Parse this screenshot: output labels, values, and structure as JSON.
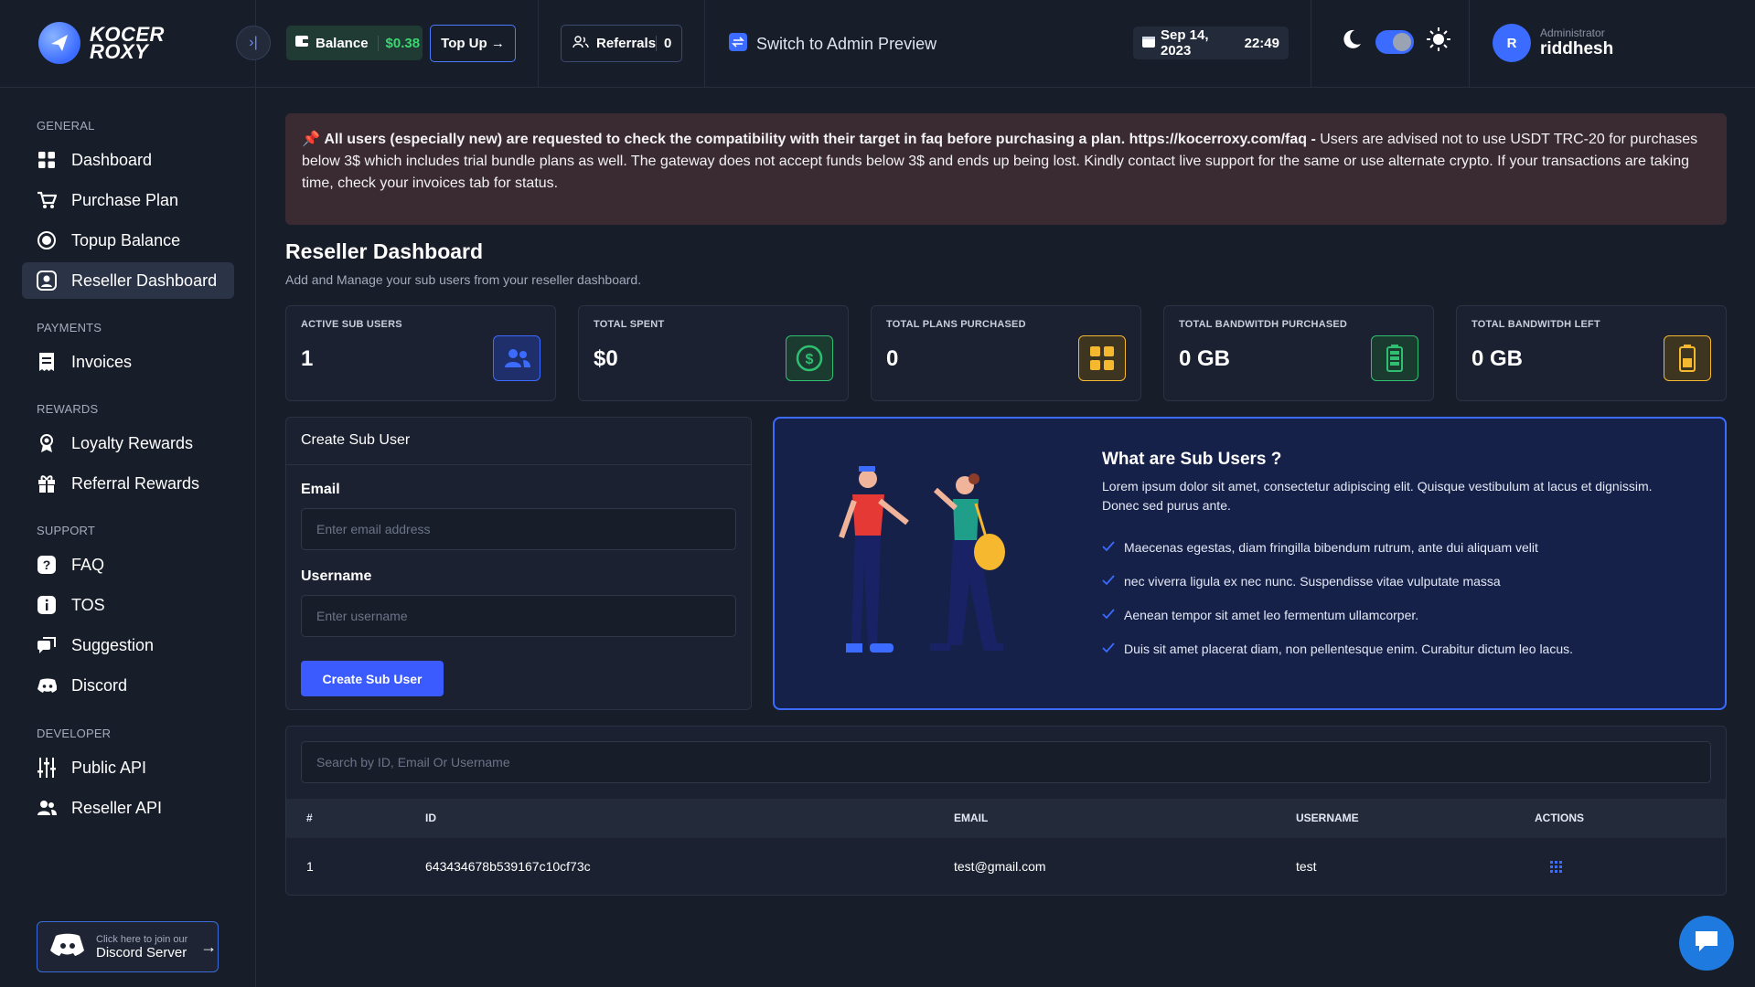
{
  "brand": {
    "line1": "KOCER",
    "line2": "ROXY"
  },
  "topbar": {
    "balance_label": "Balance",
    "balance_amount": "$0.38",
    "topup_label": "Top Up →",
    "referrals_label": "Referrals",
    "referrals_count": "0",
    "admin_preview_label": "Switch to Admin Preview",
    "date": "Sep 14, 2023",
    "time": "22:49",
    "user_role": "Administrator",
    "user_name": "riddhesh",
    "avatar_initial": "R"
  },
  "sidebar": {
    "groups": [
      {
        "title": "GENERAL",
        "items": [
          {
            "label": "Dashboard",
            "icon": "grid-icon"
          },
          {
            "label": "Purchase Plan",
            "icon": "cart-icon"
          },
          {
            "label": "Topup Balance",
            "icon": "coin-icon"
          },
          {
            "label": "Reseller Dashboard",
            "icon": "user-square-icon",
            "active": true
          }
        ]
      },
      {
        "title": "PAYMENTS",
        "items": [
          {
            "label": "Invoices",
            "icon": "invoice-icon"
          }
        ]
      },
      {
        "title": "REWARDS",
        "items": [
          {
            "label": "Loyalty Rewards",
            "icon": "medal-icon"
          },
          {
            "label": "Referral Rewards",
            "icon": "gift-icon"
          }
        ]
      },
      {
        "title": "SUPPORT",
        "items": [
          {
            "label": "FAQ",
            "icon": "question-icon"
          },
          {
            "label": "TOS",
            "icon": "info-icon"
          },
          {
            "label": "Suggestion",
            "icon": "chat-icon"
          },
          {
            "label": "Discord",
            "icon": "discord-icon"
          }
        ]
      },
      {
        "title": "DEVELOPER",
        "items": [
          {
            "label": "Public API",
            "icon": "sliders-icon"
          },
          {
            "label": "Reseller API",
            "icon": "users-icon"
          }
        ]
      }
    ],
    "discord_card": {
      "small": "Click here to join our",
      "big": "Discord Server"
    }
  },
  "notice": {
    "bold": "All users (especially new) are requested to check the compatibility with their target in faq before purchasing a plan. https://kocerroxy.com/faq -",
    "text": " Users are advised not to use USDT TRC-20 for purchases below 3$ which includes trial bundle plans as well. The gateway does not accept funds below 3$ and ends up being lost. Kindly contact live support for the same or use alternate crypto. If your transactions are taking time, check your invoices tab for status."
  },
  "page": {
    "title": "Reseller Dashboard",
    "subtitle": "Add and Manage your sub users from your reseller dashboard."
  },
  "stats": [
    {
      "label": "ACTIVE SUB USERS",
      "value": "1",
      "icon": "users-icon",
      "color": "#3b6bff"
    },
    {
      "label": "TOTAL SPENT",
      "value": "$0",
      "icon": "dollar-icon",
      "color": "#2fbf71"
    },
    {
      "label": "TOTAL PLANS PURCHASED",
      "value": "0",
      "icon": "grid-icon",
      "color": "#f5b82e"
    },
    {
      "label": "TOTAL BANDWITDH PURCHASED",
      "value": "0 GB",
      "icon": "battery-full-icon",
      "color": "#2fbf71"
    },
    {
      "label": "TOTAL BANDWITDH LEFT",
      "value": "0 GB",
      "icon": "battery-icon",
      "color": "#f5b82e"
    }
  ],
  "form": {
    "title": "Create Sub User",
    "email_label": "Email",
    "email_placeholder": "Enter email address",
    "username_label": "Username",
    "username_placeholder": "Enter username",
    "submit": "Create Sub User"
  },
  "info": {
    "title": "What are Sub Users ?",
    "para": "Lorem ipsum dolor sit amet, consectetur adipiscing elit. Quisque vestibulum at lacus et dignissim. Donec sed purus ante.",
    "bullets": [
      "Maecenas egestas, diam fringilla bibendum rutrum, ante dui aliquam velit",
      "nec viverra ligula ex nec nunc. Suspendisse vitae vulputate massa",
      "Aenean tempor sit amet leo fermentum ullamcorper.",
      "Duis sit amet placerat diam, non pellentesque enim. Curabitur dictum leo lacus."
    ]
  },
  "table": {
    "search_placeholder": "Search by ID, Email Or Username",
    "headers": [
      "#",
      "ID",
      "EMAIL",
      "USERNAME",
      "ACTIONS"
    ],
    "rows": [
      {
        "num": "1",
        "id": "643434678b539167c10cf73c",
        "email": "test@gmail.com",
        "username": "test"
      }
    ]
  }
}
